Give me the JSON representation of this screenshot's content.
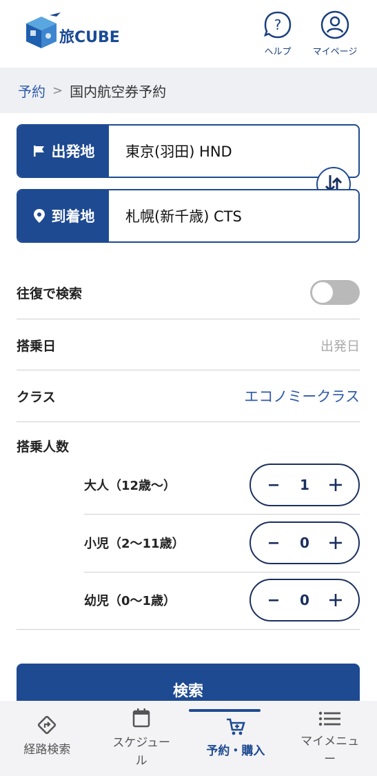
{
  "header": {
    "logo_text": "旅CUBE",
    "help_label": "ヘルプ",
    "mypage_label": "マイページ"
  },
  "breadcrumb": {
    "link": "予約",
    "separator": ">",
    "current": "国内航空券予約"
  },
  "route": {
    "departure_label": "出発地",
    "departure_value": "東京(羽田) HND",
    "arrival_label": "到着地",
    "arrival_value": "札幌(新千歳) CTS"
  },
  "options": {
    "round_trip_label": "往復で検索",
    "round_trip_on": false,
    "date_label": "搭乗日",
    "date_placeholder": "出発日",
    "class_label": "クラス",
    "class_value": "エコノミークラス",
    "passengers_label": "搭乗人数"
  },
  "passengers": [
    {
      "label": "大人（12歳〜）",
      "count": "1"
    },
    {
      "label": "小児（2〜11歳）",
      "count": "0"
    },
    {
      "label": "幼児（0〜1歳）",
      "count": "0"
    }
  ],
  "search_button": "検索",
  "nav": {
    "items": [
      {
        "label": "経路検索",
        "icon": "route-icon"
      },
      {
        "label": "スケジュール",
        "icon": "calendar-icon"
      },
      {
        "label": "予約・購入",
        "icon": "cart-icon",
        "active": true
      },
      {
        "label": "マイメニュー",
        "icon": "menu-icon"
      }
    ]
  },
  "colors": {
    "primary": "#1e4a92",
    "link": "#2e5aa8",
    "breadcrumb_bg": "#eef0f4",
    "toggle_off": "#b9b9b9"
  }
}
